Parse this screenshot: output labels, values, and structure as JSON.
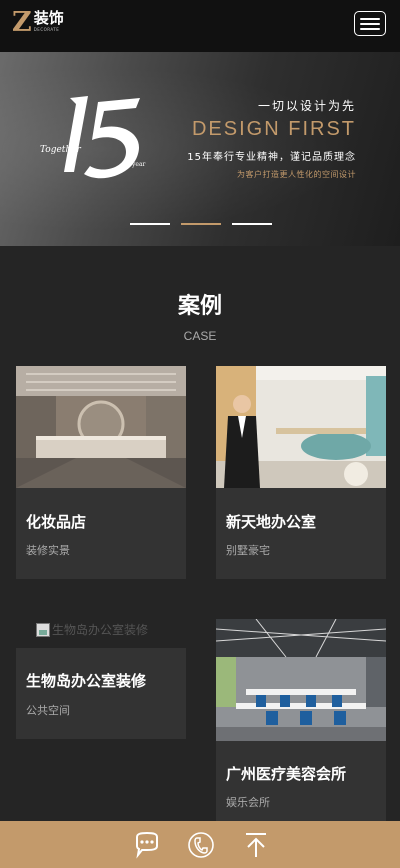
{
  "header": {
    "logo_letter": "Z",
    "logo_cn": "装饰",
    "logo_en": "DECORATE",
    "menu_icon": "hamburger-menu-icon"
  },
  "banner": {
    "big_number": "15",
    "together": "Together",
    "year": "year",
    "slogan": "一切以设计为先",
    "headline": "DESIGN FIRST",
    "line1": "15年奉行专业精神，谨记品质理念",
    "line2": "为客户打造更人性化的空间设计",
    "slides": 3,
    "active_slide": 2
  },
  "section": {
    "title": "案例",
    "subtitle": "CASE"
  },
  "cases": [
    {
      "title": "化妆品店",
      "tag": "装修实景"
    },
    {
      "title": "新天地办公室",
      "tag": "别墅豪宅"
    },
    {
      "title": "生物岛办公室装修",
      "tag": "公共空间",
      "image_alt": "生物岛办公室装修"
    },
    {
      "title": "广州医疗美容会所",
      "tag": "娱乐会所"
    }
  ],
  "footer": {
    "icons": [
      "chat-icon",
      "phone-icon",
      "back-to-top-icon"
    ]
  },
  "colors": {
    "accent": "#c39a6b",
    "background": "#252525",
    "card": "#333333",
    "header": "#111111"
  }
}
